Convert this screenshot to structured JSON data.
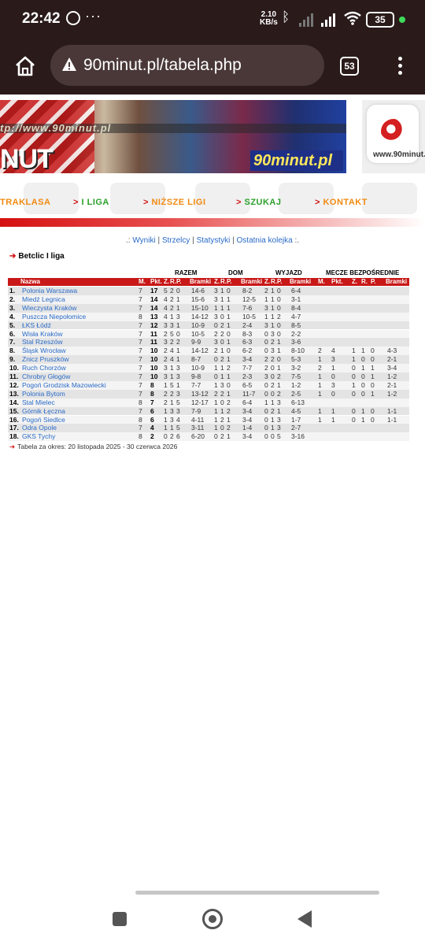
{
  "status": {
    "time": "22:42",
    "net_speed_value": "2.10",
    "net_speed_unit": "KB/s",
    "battery": "35",
    "icons": [
      "whatsapp-icon",
      "more-dots-icon",
      "bluetooth-icon",
      "signal-icon",
      "signal-icon",
      "wifi-icon",
      "battery-icon"
    ]
  },
  "browser": {
    "url": "90minut.pl/tabela.php",
    "tab_count": "53"
  },
  "banner": {
    "url_text": "tp://www.90minut.pl",
    "logo_text": "NUT",
    "brand": "90minut.pl",
    "side_logo_text": "www.90minut.pl"
  },
  "menu": {
    "items": [
      {
        "label": "TRAKLASA"
      },
      {
        "label": "I LIGA"
      },
      {
        "label": "NIŻSZE LIGI"
      },
      {
        "label": "SZUKAJ"
      },
      {
        "label": "KONTAKT"
      }
    ]
  },
  "sublinks": {
    "prefix": ".: ",
    "items": [
      "Wyniki",
      "Strzelcy",
      "Statystyki",
      "Ostatnia kolejka"
    ],
    "suffix": " :."
  },
  "league_title": "Betclic I liga",
  "table": {
    "groups": [
      "RAZEM",
      "DOM",
      "WYJAZD",
      "MECZE BEZPOŚREDNIE"
    ],
    "columns": [
      "Nazwa",
      "M.",
      "Pkt.",
      "Z.",
      "R.",
      "P.",
      "Bramki",
      "Z.",
      "R.",
      "P.",
      "Bramki",
      "Z.",
      "R.",
      "P.",
      "Bramki",
      "M.",
      "Pkt.",
      "Z.",
      "R.",
      "P.",
      "Bramki"
    ],
    "rows": [
      {
        "pos": "1.",
        "name": "Polonia Warszawa",
        "m": "7",
        "pkt": "17",
        "z": "5",
        "r": "2",
        "p": "0",
        "bramki": "14-6",
        "dz": "3",
        "dr": "1",
        "dp": "0",
        "db": "8-2",
        "wz": "2",
        "wr": "1",
        "wp": "0",
        "wb": "6-4",
        "hm": "",
        "hpkt": "",
        "hz": "",
        "hr": "",
        "hp": "",
        "hb": ""
      },
      {
        "pos": "2.",
        "name": "Miedź Legnica",
        "m": "7",
        "pkt": "14",
        "z": "4",
        "r": "2",
        "p": "1",
        "bramki": "15-6",
        "dz": "3",
        "dr": "1",
        "dp": "1",
        "db": "12-5",
        "wz": "1",
        "wr": "1",
        "wp": "0",
        "wb": "3-1",
        "hm": "",
        "hpkt": "",
        "hz": "",
        "hr": "",
        "hp": "",
        "hb": ""
      },
      {
        "pos": "3.",
        "name": "Wieczysta Kraków",
        "m": "7",
        "pkt": "14",
        "z": "4",
        "r": "2",
        "p": "1",
        "bramki": "15-10",
        "dz": "1",
        "dr": "1",
        "dp": "1",
        "db": "7-6",
        "wz": "3",
        "wr": "1",
        "wp": "0",
        "wb": "8-4",
        "hm": "",
        "hpkt": "",
        "hz": "",
        "hr": "",
        "hp": "",
        "hb": ""
      },
      {
        "pos": "4.",
        "name": "Puszcza Niepołomice",
        "m": "8",
        "pkt": "13",
        "z": "4",
        "r": "1",
        "p": "3",
        "bramki": "14-12",
        "dz": "3",
        "dr": "0",
        "dp": "1",
        "db": "10-5",
        "wz": "1",
        "wr": "1",
        "wp": "2",
        "wb": "4-7",
        "hm": "",
        "hpkt": "",
        "hz": "",
        "hr": "",
        "hp": "",
        "hb": ""
      },
      {
        "pos": "5.",
        "name": "ŁKS Łódź",
        "m": "7",
        "pkt": "12",
        "z": "3",
        "r": "3",
        "p": "1",
        "bramki": "10-9",
        "dz": "0",
        "dr": "2",
        "dp": "1",
        "db": "2-4",
        "wz": "3",
        "wr": "1",
        "wp": "0",
        "wb": "8-5",
        "hm": "",
        "hpkt": "",
        "hz": "",
        "hr": "",
        "hp": "",
        "hb": ""
      },
      {
        "pos": "6.",
        "name": "Wisła Kraków",
        "m": "7",
        "pkt": "11",
        "z": "2",
        "r": "5",
        "p": "0",
        "bramki": "10-5",
        "dz": "2",
        "dr": "2",
        "dp": "0",
        "db": "8-3",
        "wz": "0",
        "wr": "3",
        "wp": "0",
        "wb": "2-2",
        "hm": "",
        "hpkt": "",
        "hz": "",
        "hr": "",
        "hp": "",
        "hb": ""
      },
      {
        "pos": "7.",
        "name": "Stal Rzeszów",
        "m": "7",
        "pkt": "11",
        "z": "3",
        "r": "2",
        "p": "2",
        "bramki": "9-9",
        "dz": "3",
        "dr": "0",
        "dp": "1",
        "db": "6-3",
        "wz": "0",
        "wr": "2",
        "wp": "1",
        "wb": "3-6",
        "hm": "",
        "hpkt": "",
        "hz": "",
        "hr": "",
        "hp": "",
        "hb": ""
      },
      {
        "pos": "8.",
        "name": "Śląsk Wrocław",
        "m": "7",
        "pkt": "10",
        "z": "2",
        "r": "4",
        "p": "1",
        "bramki": "14-12",
        "dz": "2",
        "dr": "1",
        "dp": "0",
        "db": "6-2",
        "wz": "0",
        "wr": "3",
        "wp": "1",
        "wb": "8-10",
        "hm": "2",
        "hpkt": "4",
        "hz": "1",
        "hr": "1",
        "hp": "0",
        "hb": "4-3"
      },
      {
        "pos": "9.",
        "name": "Znicz Pruszków",
        "m": "7",
        "pkt": "10",
        "z": "2",
        "r": "4",
        "p": "1",
        "bramki": "8-7",
        "dz": "0",
        "dr": "2",
        "dp": "1",
        "db": "3-4",
        "wz": "2",
        "wr": "2",
        "wp": "0",
        "wb": "5-3",
        "hm": "1",
        "hpkt": "3",
        "hz": "1",
        "hr": "0",
        "hp": "0",
        "hb": "2-1"
      },
      {
        "pos": "10.",
        "name": "Ruch Chorzów",
        "m": "7",
        "pkt": "10",
        "z": "3",
        "r": "1",
        "p": "3",
        "bramki": "10-9",
        "dz": "1",
        "dr": "1",
        "dp": "2",
        "db": "7-7",
        "wz": "2",
        "wr": "0",
        "wp": "1",
        "wb": "3-2",
        "hm": "2",
        "hpkt": "1",
        "hz": "0",
        "hr": "1",
        "hp": "1",
        "hb": "3-4"
      },
      {
        "pos": "11.",
        "name": "Chrobry Głogów",
        "m": "7",
        "pkt": "10",
        "z": "3",
        "r": "1",
        "p": "3",
        "bramki": "9-8",
        "dz": "0",
        "dr": "1",
        "dp": "1",
        "db": "2-3",
        "wz": "3",
        "wr": "0",
        "wp": "2",
        "wb": "7-5",
        "hm": "1",
        "hpkt": "0",
        "hz": "0",
        "hr": "0",
        "hp": "1",
        "hb": "1-2"
      },
      {
        "pos": "12.",
        "name": "Pogoń Grodzisk Mazowiecki",
        "m": "7",
        "pkt": "8",
        "z": "1",
        "r": "5",
        "p": "1",
        "bramki": "7-7",
        "dz": "1",
        "dr": "3",
        "dp": "0",
        "db": "6-5",
        "wz": "0",
        "wr": "2",
        "wp": "1",
        "wb": "1-2",
        "hm": "1",
        "hpkt": "3",
        "hz": "1",
        "hr": "0",
        "hp": "0",
        "hb": "2-1"
      },
      {
        "pos": "13.",
        "name": "Polonia Bytom",
        "m": "7",
        "pkt": "8",
        "z": "2",
        "r": "2",
        "p": "3",
        "bramki": "13-12",
        "dz": "2",
        "dr": "2",
        "dp": "1",
        "db": "11-7",
        "wz": "0",
        "wr": "0",
        "wp": "2",
        "wb": "2-5",
        "hm": "1",
        "hpkt": "0",
        "hz": "0",
        "hr": "0",
        "hp": "1",
        "hb": "1-2"
      },
      {
        "pos": "14.",
        "name": "Stal Mielec",
        "m": "8",
        "pkt": "7",
        "z": "2",
        "r": "1",
        "p": "5",
        "bramki": "12-17",
        "dz": "1",
        "dr": "0",
        "dp": "2",
        "db": "6-4",
        "wz": "1",
        "wr": "1",
        "wp": "3",
        "wb": "6-13",
        "hm": "",
        "hpkt": "",
        "hz": "",
        "hr": "",
        "hp": "",
        "hb": ""
      },
      {
        "pos": "15.",
        "name": "Górnik Łęczna",
        "m": "7",
        "pkt": "6",
        "z": "1",
        "r": "3",
        "p": "3",
        "bramki": "7-9",
        "dz": "1",
        "dr": "1",
        "dp": "2",
        "db": "3-4",
        "wz": "0",
        "wr": "2",
        "wp": "1",
        "wb": "4-5",
        "hm": "1",
        "hpkt": "1",
        "hz": "0",
        "hr": "1",
        "hp": "0",
        "hb": "1-1"
      },
      {
        "pos": "16.",
        "name": "Pogoń Siedlce",
        "m": "8",
        "pkt": "6",
        "z": "1",
        "r": "3",
        "p": "4",
        "bramki": "4-11",
        "dz": "1",
        "dr": "2",
        "dp": "1",
        "db": "3-4",
        "wz": "0",
        "wr": "1",
        "wp": "3",
        "wb": "1-7",
        "hm": "1",
        "hpkt": "1",
        "hz": "0",
        "hr": "1",
        "hp": "0",
        "hb": "1-1"
      },
      {
        "pos": "17.",
        "name": "Odra Opole",
        "m": "7",
        "pkt": "4",
        "z": "1",
        "r": "1",
        "p": "5",
        "bramki": "3-11",
        "dz": "1",
        "dr": "0",
        "dp": "2",
        "db": "1-4",
        "wz": "0",
        "wr": "1",
        "wp": "3",
        "wb": "2-7",
        "hm": "",
        "hpkt": "",
        "hz": "",
        "hr": "",
        "hp": "",
        "hb": ""
      },
      {
        "pos": "18.",
        "name": "GKS Tychy",
        "m": "8",
        "pkt": "2",
        "z": "0",
        "r": "2",
        "p": "6",
        "bramki": "6-20",
        "dz": "0",
        "dr": "2",
        "dp": "1",
        "db": "3-4",
        "wz": "0",
        "wr": "0",
        "wp": "5",
        "wb": "3-16",
        "hm": "",
        "hpkt": "",
        "hz": "",
        "hr": "",
        "hp": "",
        "hb": ""
      }
    ],
    "row_colors": [
      "#e4e4e4",
      "#f4f4f4"
    ]
  },
  "footnote": "Tabela za okres: 20 listopada 2025 - 30 czerwca 2026"
}
